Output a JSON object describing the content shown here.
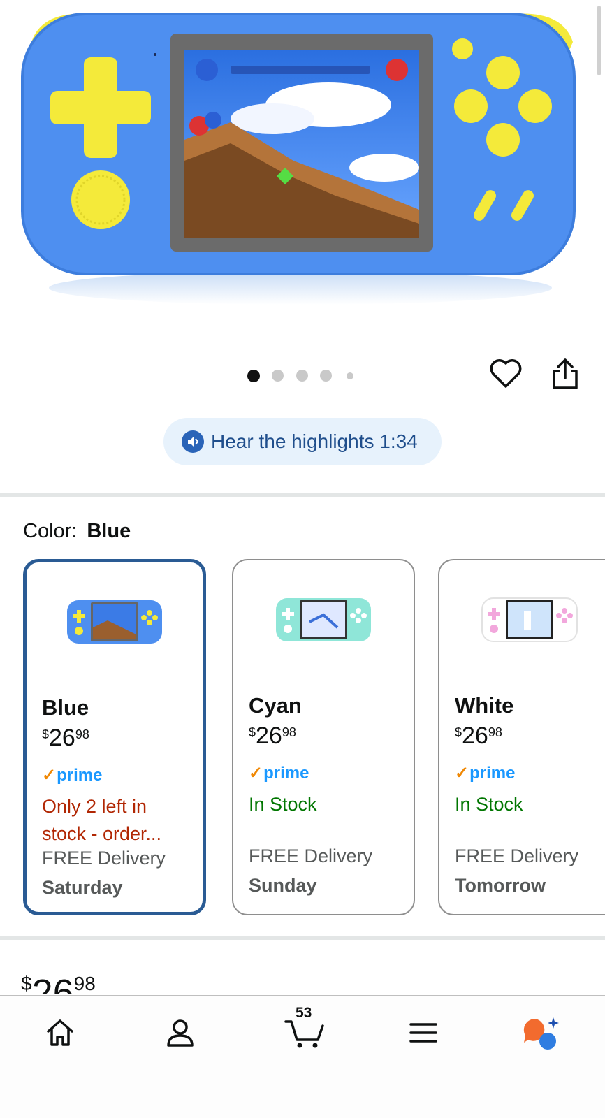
{
  "gallery": {
    "image_alt": "Blue handheld game console",
    "dots": [
      {
        "active": true
      },
      {
        "active": false
      },
      {
        "active": false
      },
      {
        "active": false
      },
      {
        "active": false
      }
    ],
    "favorite_icon": "heart-icon",
    "share_icon": "share-icon"
  },
  "highlights": {
    "icon": "speaker-icon",
    "label": "Hear the highlights 1:34"
  },
  "color": {
    "key_label": "Color:",
    "selected_value": "Blue"
  },
  "variants": [
    {
      "name": "Blue",
      "currency": "$",
      "price_whole": "26",
      "price_fraction": "98",
      "prime": "prime",
      "stock_text": "Only 2 left in stock - order...",
      "stock_status": "low",
      "delivery_label": "FREE Delivery",
      "delivery_day": "Saturday",
      "selected": true,
      "body_color": "#4e8ff0",
      "accent_color": "#f4ea3a"
    },
    {
      "name": "Cyan",
      "currency": "$",
      "price_whole": "26",
      "price_fraction": "98",
      "prime": "prime",
      "stock_text": "In Stock",
      "stock_status": "in",
      "delivery_label": "FREE Delivery",
      "delivery_day": "Sunday",
      "selected": false,
      "body_color": "#8fe6d8",
      "accent_color": "#ffffff"
    },
    {
      "name": "White",
      "currency": "$",
      "price_whole": "26",
      "price_fraction": "98",
      "prime": "prime",
      "stock_text": "In Stock",
      "stock_status": "in",
      "delivery_label": "FREE Delivery",
      "delivery_day": "Tomorrow",
      "selected": false,
      "body_color": "#ffffff",
      "accent_color": "#f2a7dc"
    }
  ],
  "price": {
    "currency": "$",
    "whole": "26",
    "fraction": "98"
  },
  "nav": {
    "home_icon": "home-icon",
    "account_icon": "account-icon",
    "cart_icon": "cart-icon",
    "cart_count": "53",
    "menu_icon": "menu-icon",
    "rufus_icon": "rufus-assistant-icon"
  },
  "colors": {
    "accent_blue": "#2a5b94",
    "prime_blue": "#1a98ff",
    "low_stock_red": "#b12704",
    "in_stock_green": "#007600",
    "pill_bg": "#e7f2fc"
  }
}
